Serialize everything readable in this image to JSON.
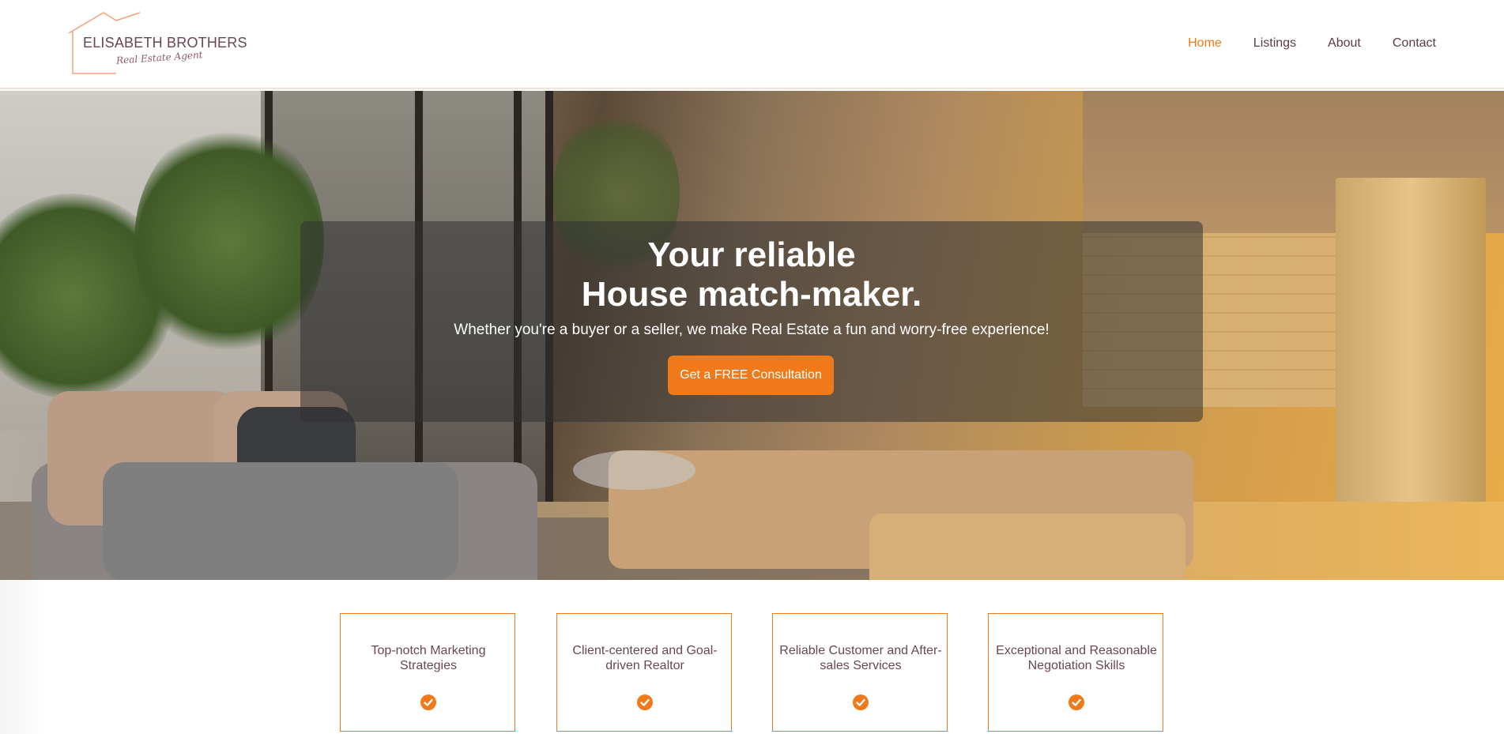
{
  "brand": {
    "name": "ELISABETH BROTHERS",
    "tagline": "Real Estate Agent",
    "accent_color": "#f07a1a"
  },
  "nav": {
    "items": [
      {
        "label": "Home",
        "active": true
      },
      {
        "label": "Listings",
        "active": false
      },
      {
        "label": "About",
        "active": false
      },
      {
        "label": "Contact",
        "active": false
      }
    ]
  },
  "hero": {
    "title_line1": "Your reliable",
    "title_line2": "House match-maker.",
    "subtitle": "Whether you're a buyer or a seller, we make Real Estate a fun and worry-free experience!",
    "cta_label": "Get a FREE Consultation"
  },
  "features": [
    {
      "text": "Top-notch Marketing Strategies",
      "icon": "check-circle-icon"
    },
    {
      "text": "Client-centered and Goal-driven Realtor",
      "icon": "check-circle-icon"
    },
    {
      "text": "Reliable Customer and After-sales Services",
      "icon": "check-circle-icon"
    },
    {
      "text": "Exceptional and Reasonable Negotiation Skills",
      "icon": "check-circle-icon"
    }
  ]
}
